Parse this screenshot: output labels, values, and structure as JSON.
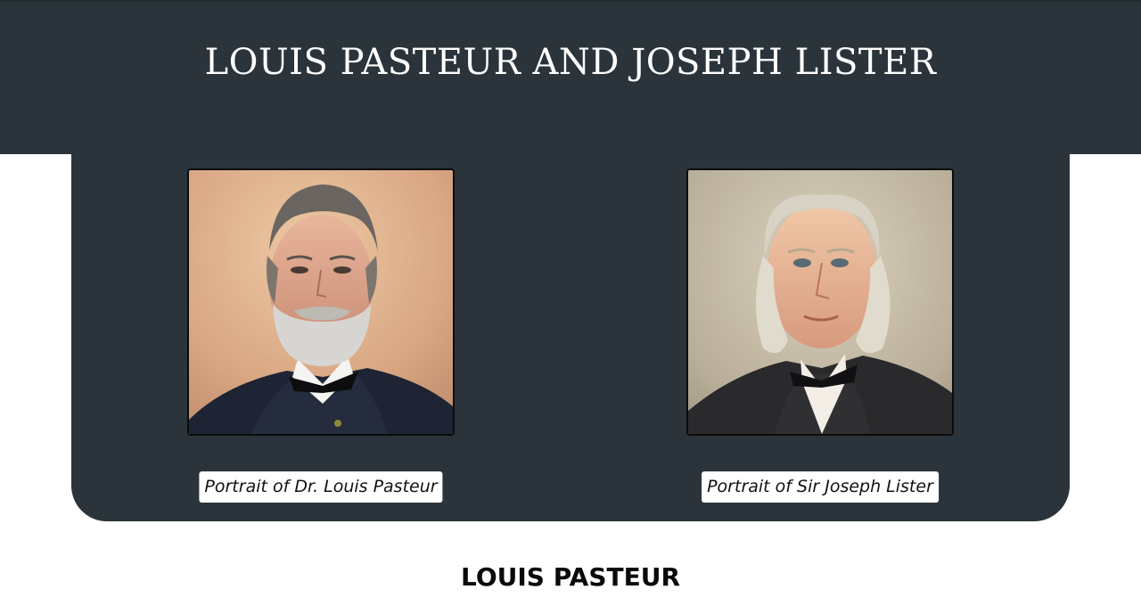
{
  "header": {
    "title": "LOUIS PASTEUR AND JOSEPH LISTER"
  },
  "portraits": [
    {
      "image": "portrait-of-louis-pasteur",
      "caption": "Portrait of Dr. Louis Pasteur"
    },
    {
      "image": "portrait-of-joseph-lister",
      "caption": "Portrait of Sir Joseph Lister"
    }
  ],
  "sections": {
    "first_heading": "LOUIS PASTEUR"
  },
  "colors": {
    "header_background": "#2a343a",
    "caption_background": "#ffffff",
    "page_background": "#ffffff"
  }
}
